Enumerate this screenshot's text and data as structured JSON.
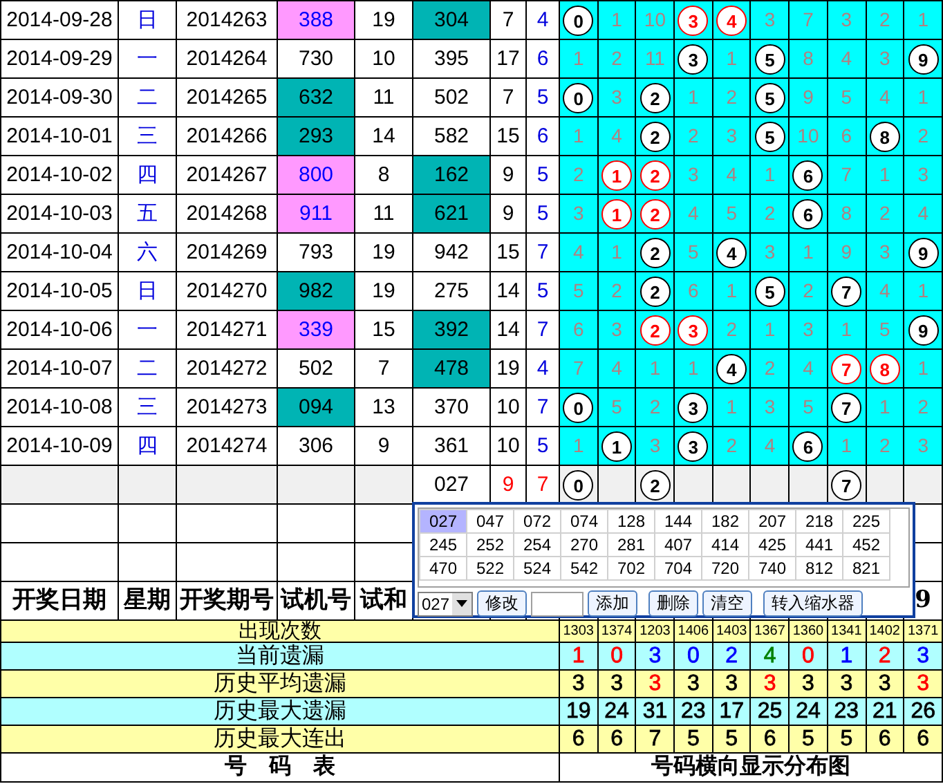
{
  "rows": [
    {
      "date": "2014-09-28",
      "weekday": "日",
      "issue": "2014263",
      "trial": {
        "text": "388",
        "color": "#ff99ff"
      },
      "trial_sum": "19",
      "draw": {
        "text": "304",
        "color": "#00b4b4"
      },
      "sum": "7",
      "span": "4",
      "cells": [
        {
          "kind": "ball",
          "text": "0"
        },
        {
          "kind": "miss",
          "text": "1"
        },
        {
          "kind": "miss",
          "text": "10"
        },
        {
          "kind": "red-ball",
          "text": "3"
        },
        {
          "kind": "red-ball",
          "text": "4"
        },
        {
          "kind": "miss",
          "text": "3"
        },
        {
          "kind": "miss",
          "text": "7"
        },
        {
          "kind": "miss",
          "text": "3"
        },
        {
          "kind": "miss",
          "text": "2"
        },
        {
          "kind": "miss",
          "text": "1"
        }
      ]
    },
    {
      "date": "2014-09-29",
      "weekday": "一",
      "issue": "2014264",
      "trial": {
        "text": "730"
      },
      "trial_sum": "10",
      "draw": {
        "text": "395"
      },
      "sum": "17",
      "span": "6",
      "cells": [
        {
          "kind": "miss",
          "text": "1"
        },
        {
          "kind": "miss",
          "text": "2"
        },
        {
          "kind": "miss",
          "text": "11"
        },
        {
          "kind": "ball",
          "text": "3"
        },
        {
          "kind": "miss",
          "text": "1"
        },
        {
          "kind": "ball",
          "text": "5"
        },
        {
          "kind": "miss",
          "text": "8"
        },
        {
          "kind": "miss",
          "text": "4"
        },
        {
          "kind": "miss",
          "text": "3"
        },
        {
          "kind": "ball",
          "text": "9"
        }
      ]
    },
    {
      "date": "2014-09-30",
      "weekday": "二",
      "issue": "2014265",
      "trial": {
        "text": "632",
        "color": "#00b4b4"
      },
      "trial_sum": "11",
      "draw": {
        "text": "502"
      },
      "sum": "7",
      "span": "5",
      "cells": [
        {
          "kind": "ball",
          "text": "0"
        },
        {
          "kind": "miss",
          "text": "3"
        },
        {
          "kind": "ball",
          "text": "2"
        },
        {
          "kind": "miss",
          "text": "1"
        },
        {
          "kind": "miss",
          "text": "2"
        },
        {
          "kind": "ball",
          "text": "5"
        },
        {
          "kind": "miss",
          "text": "9"
        },
        {
          "kind": "miss",
          "text": "5"
        },
        {
          "kind": "miss",
          "text": "4"
        },
        {
          "kind": "miss",
          "text": "1"
        }
      ]
    },
    {
      "date": "2014-10-01",
      "weekday": "三",
      "issue": "2014266",
      "trial": {
        "text": "293",
        "color": "#00b4b4"
      },
      "trial_sum": "14",
      "draw": {
        "text": "582"
      },
      "sum": "15",
      "span": "6",
      "cells": [
        {
          "kind": "miss",
          "text": "1"
        },
        {
          "kind": "miss",
          "text": "4"
        },
        {
          "kind": "ball",
          "text": "2"
        },
        {
          "kind": "miss",
          "text": "2"
        },
        {
          "kind": "miss",
          "text": "3"
        },
        {
          "kind": "ball",
          "text": "5"
        },
        {
          "kind": "miss",
          "text": "10"
        },
        {
          "kind": "miss",
          "text": "6"
        },
        {
          "kind": "ball",
          "text": "8"
        },
        {
          "kind": "miss",
          "text": "2"
        }
      ]
    },
    {
      "date": "2014-10-02",
      "weekday": "四",
      "issue": "2014267",
      "trial": {
        "text": "800",
        "color": "#ff99ff"
      },
      "trial_sum": "8",
      "draw": {
        "text": "162",
        "color": "#00b4b4"
      },
      "sum": "9",
      "span": "5",
      "cells": [
        {
          "kind": "miss",
          "text": "2"
        },
        {
          "kind": "red-ball",
          "text": "1"
        },
        {
          "kind": "red-ball",
          "text": "2"
        },
        {
          "kind": "miss",
          "text": "3"
        },
        {
          "kind": "miss",
          "text": "4"
        },
        {
          "kind": "miss",
          "text": "1"
        },
        {
          "kind": "ball",
          "text": "6"
        },
        {
          "kind": "miss",
          "text": "7"
        },
        {
          "kind": "miss",
          "text": "1"
        },
        {
          "kind": "miss",
          "text": "3"
        }
      ]
    },
    {
      "date": "2014-10-03",
      "weekday": "五",
      "issue": "2014268",
      "trial": {
        "text": "911",
        "color": "#ff99ff"
      },
      "trial_sum": "11",
      "draw": {
        "text": "621",
        "color": "#00b4b4"
      },
      "sum": "9",
      "span": "5",
      "cells": [
        {
          "kind": "miss",
          "text": "3"
        },
        {
          "kind": "red-ball",
          "text": "1"
        },
        {
          "kind": "red-ball",
          "text": "2"
        },
        {
          "kind": "miss",
          "text": "4"
        },
        {
          "kind": "miss",
          "text": "5"
        },
        {
          "kind": "miss",
          "text": "2"
        },
        {
          "kind": "ball",
          "text": "6"
        },
        {
          "kind": "miss",
          "text": "8"
        },
        {
          "kind": "miss",
          "text": "2"
        },
        {
          "kind": "miss",
          "text": "4"
        }
      ]
    },
    {
      "date": "2014-10-04",
      "weekday": "六",
      "issue": "2014269",
      "trial": {
        "text": "793"
      },
      "trial_sum": "19",
      "draw": {
        "text": "942"
      },
      "sum": "15",
      "span": "7",
      "cells": [
        {
          "kind": "miss",
          "text": "4"
        },
        {
          "kind": "miss",
          "text": "1"
        },
        {
          "kind": "ball",
          "text": "2"
        },
        {
          "kind": "miss",
          "text": "5"
        },
        {
          "kind": "ball",
          "text": "4"
        },
        {
          "kind": "miss",
          "text": "3"
        },
        {
          "kind": "miss",
          "text": "1"
        },
        {
          "kind": "miss",
          "text": "9"
        },
        {
          "kind": "miss",
          "text": "3"
        },
        {
          "kind": "ball",
          "text": "9"
        }
      ]
    },
    {
      "date": "2014-10-05",
      "weekday": "日",
      "issue": "2014270",
      "trial": {
        "text": "982",
        "color": "#00b4b4"
      },
      "trial_sum": "19",
      "draw": {
        "text": "275"
      },
      "sum": "14",
      "span": "5",
      "cells": [
        {
          "kind": "miss",
          "text": "5"
        },
        {
          "kind": "miss",
          "text": "2"
        },
        {
          "kind": "ball",
          "text": "2"
        },
        {
          "kind": "miss",
          "text": "6"
        },
        {
          "kind": "miss",
          "text": "1"
        },
        {
          "kind": "ball",
          "text": "5"
        },
        {
          "kind": "miss",
          "text": "2"
        },
        {
          "kind": "ball",
          "text": "7"
        },
        {
          "kind": "miss",
          "text": "4"
        },
        {
          "kind": "miss",
          "text": "1"
        }
      ]
    },
    {
      "date": "2014-10-06",
      "weekday": "一",
      "issue": "2014271",
      "trial": {
        "text": "339",
        "color": "#ff99ff"
      },
      "trial_sum": "15",
      "draw": {
        "text": "392",
        "color": "#00b4b4"
      },
      "sum": "14",
      "span": "7",
      "cells": [
        {
          "kind": "miss",
          "text": "6"
        },
        {
          "kind": "miss",
          "text": "3"
        },
        {
          "kind": "red-ball",
          "text": "2"
        },
        {
          "kind": "red-ball",
          "text": "3"
        },
        {
          "kind": "miss",
          "text": "2"
        },
        {
          "kind": "miss",
          "text": "1"
        },
        {
          "kind": "miss",
          "text": "3"
        },
        {
          "kind": "miss",
          "text": "1"
        },
        {
          "kind": "miss",
          "text": "5"
        },
        {
          "kind": "ball",
          "text": "9"
        }
      ]
    },
    {
      "date": "2014-10-07",
      "weekday": "二",
      "issue": "2014272",
      "trial": {
        "text": "502"
      },
      "trial_sum": "7",
      "draw": {
        "text": "478",
        "color": "#00b4b4"
      },
      "sum": "19",
      "span": "4",
      "cells": [
        {
          "kind": "miss",
          "text": "7"
        },
        {
          "kind": "miss",
          "text": "4"
        },
        {
          "kind": "miss",
          "text": "1"
        },
        {
          "kind": "miss",
          "text": "1"
        },
        {
          "kind": "ball",
          "text": "4"
        },
        {
          "kind": "miss",
          "text": "2"
        },
        {
          "kind": "miss",
          "text": "4"
        },
        {
          "kind": "red-ball",
          "text": "7"
        },
        {
          "kind": "red-ball",
          "text": "8"
        },
        {
          "kind": "miss",
          "text": "1"
        }
      ]
    },
    {
      "date": "2014-10-08",
      "weekday": "三",
      "issue": "2014273",
      "trial": {
        "text": "094",
        "color": "#00b4b4"
      },
      "trial_sum": "13",
      "draw": {
        "text": "370"
      },
      "sum": "10",
      "span": "7",
      "cells": [
        {
          "kind": "ball",
          "text": "0"
        },
        {
          "kind": "miss",
          "text": "5"
        },
        {
          "kind": "miss",
          "text": "2"
        },
        {
          "kind": "ball",
          "text": "3"
        },
        {
          "kind": "miss",
          "text": "1"
        },
        {
          "kind": "miss",
          "text": "3"
        },
        {
          "kind": "miss",
          "text": "5"
        },
        {
          "kind": "ball",
          "text": "7"
        },
        {
          "kind": "miss",
          "text": "1"
        },
        {
          "kind": "miss",
          "text": "2"
        }
      ]
    },
    {
      "date": "2014-10-09",
      "weekday": "四",
      "issue": "2014274",
      "trial": {
        "text": "306"
      },
      "trial_sum": "9",
      "draw": {
        "text": "361"
      },
      "sum": "10",
      "span": "5",
      "cells": [
        {
          "kind": "miss",
          "text": "1"
        },
        {
          "kind": "ball",
          "text": "1"
        },
        {
          "kind": "miss",
          "text": "3"
        },
        {
          "kind": "ball",
          "text": "3"
        },
        {
          "kind": "miss",
          "text": "2"
        },
        {
          "kind": "miss",
          "text": "4"
        },
        {
          "kind": "ball",
          "text": "6"
        },
        {
          "kind": "miss",
          "text": "1"
        },
        {
          "kind": "miss",
          "text": "2"
        },
        {
          "kind": "miss",
          "text": "3"
        }
      ]
    }
  ],
  "summary": {
    "draw": "027",
    "sum": "9",
    "span": "7",
    "cells": [
      {
        "kind": "ball",
        "text": "0"
      },
      {
        "kind": "blank"
      },
      {
        "kind": "ball",
        "text": "2"
      },
      {
        "kind": "blank"
      },
      {
        "kind": "blank"
      },
      {
        "kind": "blank"
      },
      {
        "kind": "blank"
      },
      {
        "kind": "ball",
        "text": "7"
      },
      {
        "kind": "blank"
      },
      {
        "kind": "blank"
      }
    ]
  },
  "headers": [
    "开奖日期",
    "星期",
    "开奖期号",
    "试机号",
    "试和"
  ],
  "grid_header_last": "9",
  "stats": [
    {
      "label": "出现次数",
      "kind": "count",
      "values": [
        {
          "text": "1303"
        },
        {
          "text": "1374"
        },
        {
          "text": "1203"
        },
        {
          "text": "1406"
        },
        {
          "text": "1403"
        },
        {
          "text": "1367"
        },
        {
          "text": "1360"
        },
        {
          "text": "1341"
        },
        {
          "text": "1402"
        },
        {
          "text": "1371"
        }
      ]
    },
    {
      "label": "当前遗漏",
      "kind": "plain",
      "values": [
        {
          "text": "1",
          "color": "#ff0000"
        },
        {
          "text": "0",
          "color": "#ff0000"
        },
        {
          "text": "3",
          "color": "#0000ff"
        },
        {
          "text": "0",
          "color": "#0000ff"
        },
        {
          "text": "2",
          "color": "#0000ff"
        },
        {
          "text": "4",
          "color": "#008000"
        },
        {
          "text": "0",
          "color": "#ff0000"
        },
        {
          "text": "1",
          "color": "#0000ff"
        },
        {
          "text": "2",
          "color": "#ff0000"
        },
        {
          "text": "3",
          "color": "#0000ff"
        }
      ]
    },
    {
      "label": "历史平均遗漏",
      "kind": "plain",
      "values": [
        {
          "text": "3",
          "color": "#000000"
        },
        {
          "text": "3",
          "color": "#000000"
        },
        {
          "text": "3",
          "color": "#ff0000"
        },
        {
          "text": "3",
          "color": "#000000"
        },
        {
          "text": "3",
          "color": "#000000"
        },
        {
          "text": "3",
          "color": "#ff0000"
        },
        {
          "text": "3",
          "color": "#000000"
        },
        {
          "text": "3",
          "color": "#000000"
        },
        {
          "text": "3",
          "color": "#000000"
        },
        {
          "text": "3",
          "color": "#ff0000"
        }
      ]
    },
    {
      "label": "历史最大遗漏",
      "kind": "plain",
      "values": [
        {
          "text": "19"
        },
        {
          "text": "24"
        },
        {
          "text": "31"
        },
        {
          "text": "23"
        },
        {
          "text": "17"
        },
        {
          "text": "25"
        },
        {
          "text": "24"
        },
        {
          "text": "23"
        },
        {
          "text": "21"
        },
        {
          "text": "26"
        }
      ]
    },
    {
      "label": "历史最大连出",
      "kind": "plain",
      "values": [
        {
          "text": "6"
        },
        {
          "text": "6"
        },
        {
          "text": "7"
        },
        {
          "text": "5"
        },
        {
          "text": "5"
        },
        {
          "text": "6"
        },
        {
          "text": "5"
        },
        {
          "text": "5"
        },
        {
          "text": "6"
        },
        {
          "text": "6"
        }
      ]
    }
  ],
  "footer": [
    "号　码　表",
    "号码横向显示分布图"
  ],
  "picker": {
    "options": [
      {
        "text": "027",
        "selected": true
      },
      {
        "text": "047",
        "selected": false
      },
      {
        "text": "072",
        "selected": false
      },
      {
        "text": "074",
        "selected": false
      },
      {
        "text": "128",
        "selected": false
      },
      {
        "text": "144",
        "selected": false
      },
      {
        "text": "182",
        "selected": false
      },
      {
        "text": "207",
        "selected": false
      },
      {
        "text": "218",
        "selected": false
      },
      {
        "text": "225",
        "selected": false
      },
      {
        "text": "245",
        "selected": false
      },
      {
        "text": "252",
        "selected": false
      },
      {
        "text": "254",
        "selected": false
      },
      {
        "text": "270",
        "selected": false
      },
      {
        "text": "281",
        "selected": false
      },
      {
        "text": "407",
        "selected": false
      },
      {
        "text": "414",
        "selected": false
      },
      {
        "text": "425",
        "selected": false
      },
      {
        "text": "441",
        "selected": false
      },
      {
        "text": "452",
        "selected": false
      },
      {
        "text": "470",
        "selected": false
      },
      {
        "text": "522",
        "selected": false
      },
      {
        "text": "524",
        "selected": false
      },
      {
        "text": "542",
        "selected": false
      },
      {
        "text": "702",
        "selected": false
      },
      {
        "text": "704",
        "selected": false
      },
      {
        "text": "720",
        "selected": false
      },
      {
        "text": "740",
        "selected": false
      },
      {
        "text": "812",
        "selected": false
      },
      {
        "text": "821",
        "selected": false
      }
    ],
    "combo": "027",
    "buttons": [
      "修改",
      "添加",
      "删除",
      "清空",
      "转入缩水器"
    ]
  }
}
